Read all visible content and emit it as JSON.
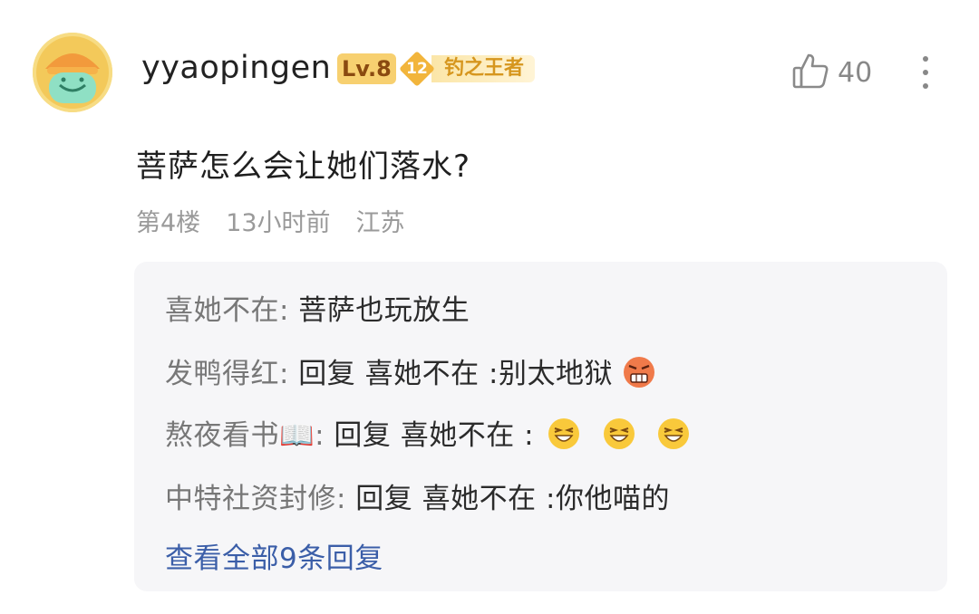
{
  "comment": {
    "username": "yyaopingen",
    "level": "Lv.8",
    "medal_level": "12",
    "medal_title": "钓之王者",
    "like_count": "40",
    "text": "菩萨怎么会让她们落水?",
    "floor": "第4楼",
    "time": "13小时前",
    "location": "江苏",
    "icons": {
      "avatar": "avatar-icon",
      "like": "thumbs-up-icon",
      "more": "more-vertical-icon"
    }
  },
  "replies": [
    {
      "name": "喜她不在:",
      "text": " 菩萨也玩放生",
      "emojis": []
    },
    {
      "name": "发鸭得红:",
      "text": " 回复 喜她不在 :别太地狱",
      "emojis": [
        "angry-face-emoji"
      ]
    },
    {
      "name": "熬夜看书📖:",
      "text": " 回复 喜她不在 :",
      "emojis": [
        "laughing-face-emoji",
        "laughing-face-emoji",
        "laughing-face-emoji"
      ]
    },
    {
      "name": "中特社资封修:",
      "text": " 回复 喜她不在 :你他喵的",
      "emojis": []
    }
  ],
  "view_all_label": "查看全部9条回复",
  "colors": {
    "link": "#3b5ea8",
    "level_badge": "#f7d070",
    "medal": "#f2b53c",
    "reply_bg": "#f6f6f8"
  }
}
